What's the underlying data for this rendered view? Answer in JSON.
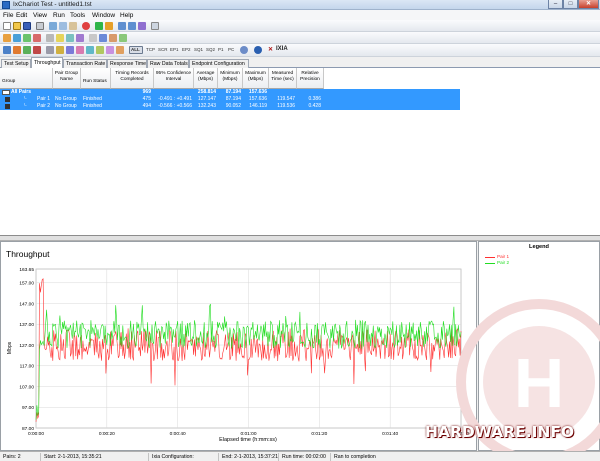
{
  "window": {
    "title": "IxChariot Test - untitled1.tst",
    "min": "–",
    "max": "□",
    "close": "✕"
  },
  "menu": [
    "File",
    "Edit",
    "View",
    "Run",
    "Tools",
    "Window",
    "Help"
  ],
  "toolbar2_labels": {
    "all": "ALL",
    "tcp": "TCP",
    "scr": "SCR",
    "ep1": "EP1",
    "ep2": "EP2",
    "sq1": "SQ1",
    "sq2": "SQ2",
    "pc1": "P1",
    "pc2": "PC",
    "ixia": "IXIA"
  },
  "tabs": [
    "Test Setup",
    "Throughput",
    "Transaction Rate",
    "Response Time",
    "Raw Data Totals",
    "Endpoint Configuration"
  ],
  "active_tab": 1,
  "grid": {
    "headers": [
      "Group",
      "Pair Group Name",
      "Run Status",
      "Timing Records Completed",
      "95% Confidence Interval",
      "Average (Mbps)",
      "Minimum (Mbps)",
      "Maximum (Mbps)",
      "Measured Time (sec)",
      "Relative Precision"
    ],
    "all_pairs": {
      "label": "All Pairs",
      "records": "969",
      "average": "258.814",
      "minimum": "87.194",
      "maximum": "157.636"
    },
    "pairs": [
      {
        "name": "Pair 1",
        "group": "No Group",
        "status": "Finished",
        "records": "475",
        "ci": "-0.491 : +0.491",
        "average": "127.147",
        "minimum": "87.194",
        "maximum": "157.636",
        "time": "119.547",
        "precision": "0.386"
      },
      {
        "name": "Pair 2",
        "group": "No Group",
        "status": "Finished",
        "records": "494",
        "ci": "-0.566 : +0.566",
        "average": "132.243",
        "minimum": "90.052",
        "maximum": "146.119",
        "time": "119.536",
        "precision": "0.428"
      }
    ]
  },
  "chart_data": {
    "type": "line",
    "title": "Throughput",
    "xlabel": "Elapsed time (h:mm:ss)",
    "ylabel": "Mbps",
    "yticks": [
      "163.65",
      "157.00",
      "147.00",
      "137.00",
      "127.00",
      "117.00",
      "107.00",
      "97.00",
      "87.00"
    ],
    "ylim": [
      87,
      163.65
    ],
    "xticks": [
      "0:00:00",
      "0:00:20",
      "0:00:40",
      "0:01:00",
      "0:01:20",
      "0:01:40",
      "0:02:00"
    ],
    "xlim_sec": [
      0,
      120
    ],
    "series": [
      {
        "name": "Pair 1",
        "color": "#ff3030",
        "mean": 127.1
      },
      {
        "name": "Pair 2",
        "color": "#22dd22",
        "mean": 132.2
      }
    ]
  },
  "legend": {
    "title": "Legend",
    "items": [
      {
        "label": "Pair 1",
        "color": "#ff3030"
      },
      {
        "label": "Pair 2",
        "color": "#22dd22"
      }
    ]
  },
  "status": {
    "pairs": "Pairs: 2",
    "start": "Start: 2-1-2013, 15:35:21",
    "ixia": "Ixia Configuration:",
    "end": "End: 2-1-2013, 15:37:21",
    "runtime": "Run time: 00:02:00",
    "completion": "Ran to completion"
  },
  "watermark": "HARDWARE.INFO"
}
